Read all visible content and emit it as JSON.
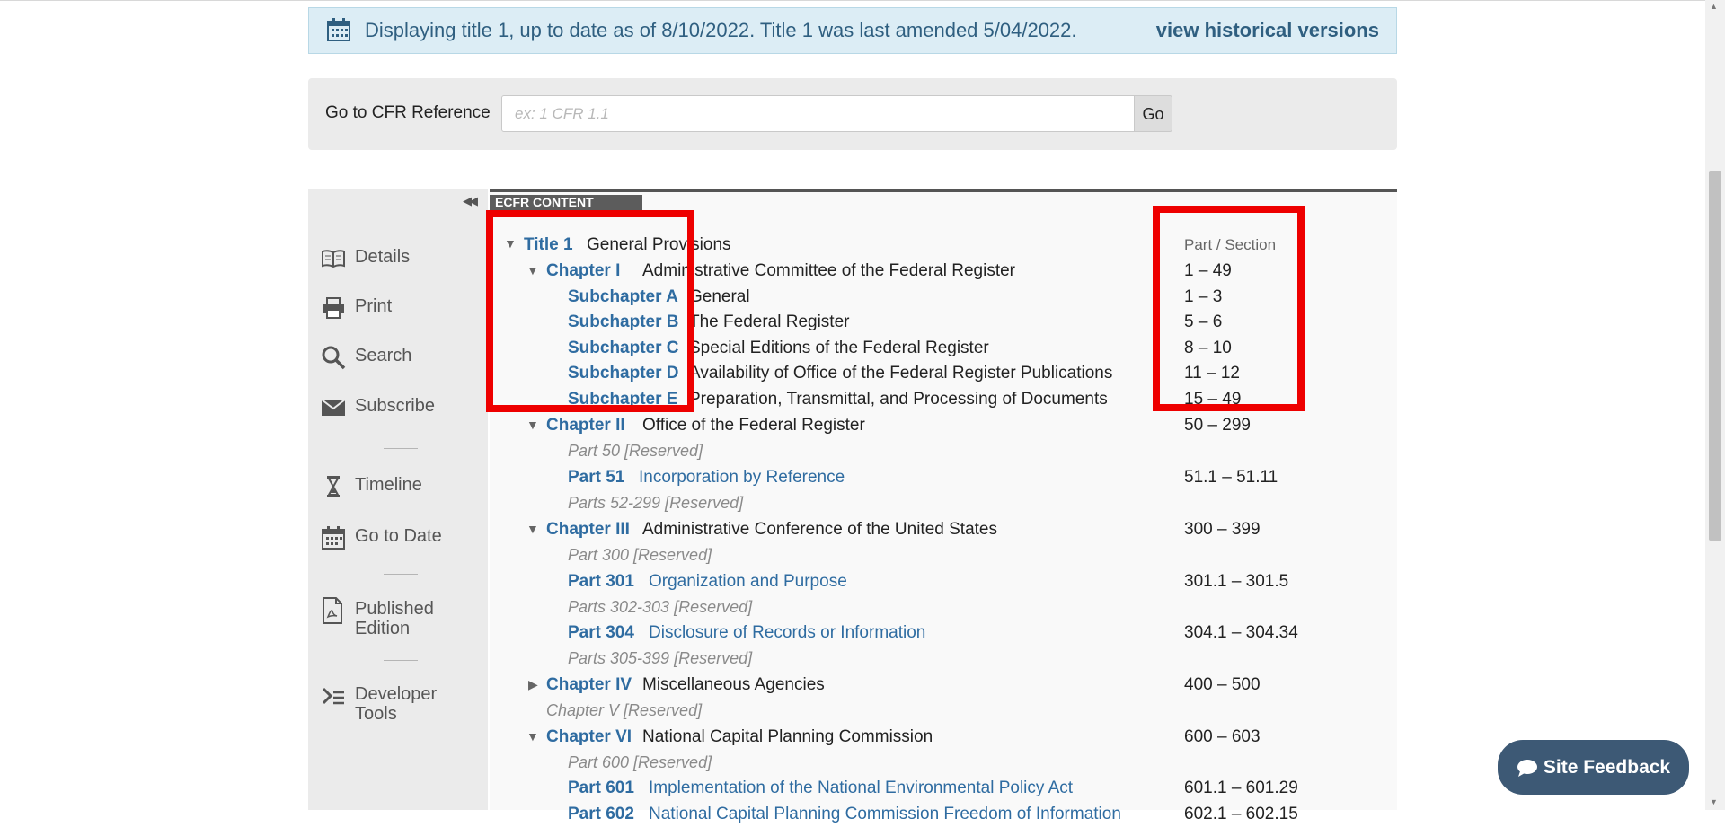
{
  "banner": {
    "text": "Displaying title 1, up to date as of 8/10/2022. Title 1 was last amended 5/04/2022.",
    "link": "view historical versions"
  },
  "goto": {
    "label": "Go to CFR Reference",
    "placeholder": "ex: 1 CFR 1.1",
    "button": "Go"
  },
  "sidebar": {
    "collapse": "◀◀",
    "items": [
      {
        "label": "Details",
        "icon": "book-icon"
      },
      {
        "label": "Print",
        "icon": "printer-icon"
      },
      {
        "label": "Search",
        "icon": "search-icon"
      },
      {
        "label": "Subscribe",
        "icon": "envelope-icon"
      },
      {
        "label": "Timeline",
        "icon": "hourglass-icon"
      },
      {
        "label": "Go to Date",
        "icon": "calendar-icon"
      },
      {
        "label": "Published Edition",
        "icon": "pdf-icon"
      },
      {
        "label": "Developer Tools",
        "icon": "terminal-icon"
      }
    ]
  },
  "content": {
    "tag": "ECFR CONTENT",
    "column_header": "Part / Section",
    "title": {
      "link": "Title 1",
      "desc": "General Provisions"
    },
    "rows": [
      {
        "link": "Chapter I",
        "desc": "Administrative Committee of the Federal Register",
        "range": "1 – 49"
      },
      {
        "link": "Subchapter A",
        "desc": "General",
        "range": "1 – 3"
      },
      {
        "link": "Subchapter B",
        "desc": "The Federal Register",
        "range": "5 – 6"
      },
      {
        "link": "Subchapter C",
        "desc": "Special Editions of the Federal Register",
        "range": "8 – 10"
      },
      {
        "link": "Subchapter D",
        "desc": "Availability of Office of the Federal Register Publications",
        "range": "11 – 12"
      },
      {
        "link": "Subchapter E",
        "desc": "Preparation, Transmittal, and Processing of Documents",
        "range": "15 – 49"
      },
      {
        "link": "Chapter II",
        "desc": "Office of the Federal Register",
        "range": "50 – 299"
      },
      {
        "reserved": "Part 50 [Reserved]"
      },
      {
        "link": "Part 51",
        "desc": "Incorporation by Reference",
        "range": "51.1 – 51.11"
      },
      {
        "reserved": "Parts 52-299 [Reserved]"
      },
      {
        "link": "Chapter III",
        "desc": "Administrative Conference of the United States",
        "range": "300 – 399"
      },
      {
        "reserved": "Part 300 [Reserved]"
      },
      {
        "link": "Part 301",
        "desc": "Organization and Purpose",
        "range": "301.1 – 301.5"
      },
      {
        "reserved": "Parts 302-303 [Reserved]"
      },
      {
        "link": "Part 304",
        "desc": "Disclosure of Records or Information",
        "range": "304.1 – 304.34"
      },
      {
        "reserved": "Parts 305-399 [Reserved]"
      },
      {
        "link": "Chapter IV",
        "desc": "Miscellaneous Agencies",
        "range": "400 – 500"
      },
      {
        "reserved": "Chapter V [Reserved]"
      },
      {
        "link": "Chapter VI",
        "desc": "National Capital Planning Commission",
        "range": "600 – 603"
      },
      {
        "reserved": "Part 600 [Reserved]"
      },
      {
        "link": "Part 601",
        "desc": "Implementation of the National Environmental Policy Act",
        "range": "601.1 – 601.29"
      },
      {
        "link": "Part 602",
        "desc": "National Capital Planning Commission Freedom of Information",
        "range": "602.1 – 602.15"
      }
    ]
  },
  "feedback": {
    "label": "Site Feedback"
  },
  "colors": {
    "link": "#2f6ca1",
    "highlight": "#ee0000",
    "feedback": "#3d5975",
    "banner_bg": "#dcedf5"
  }
}
